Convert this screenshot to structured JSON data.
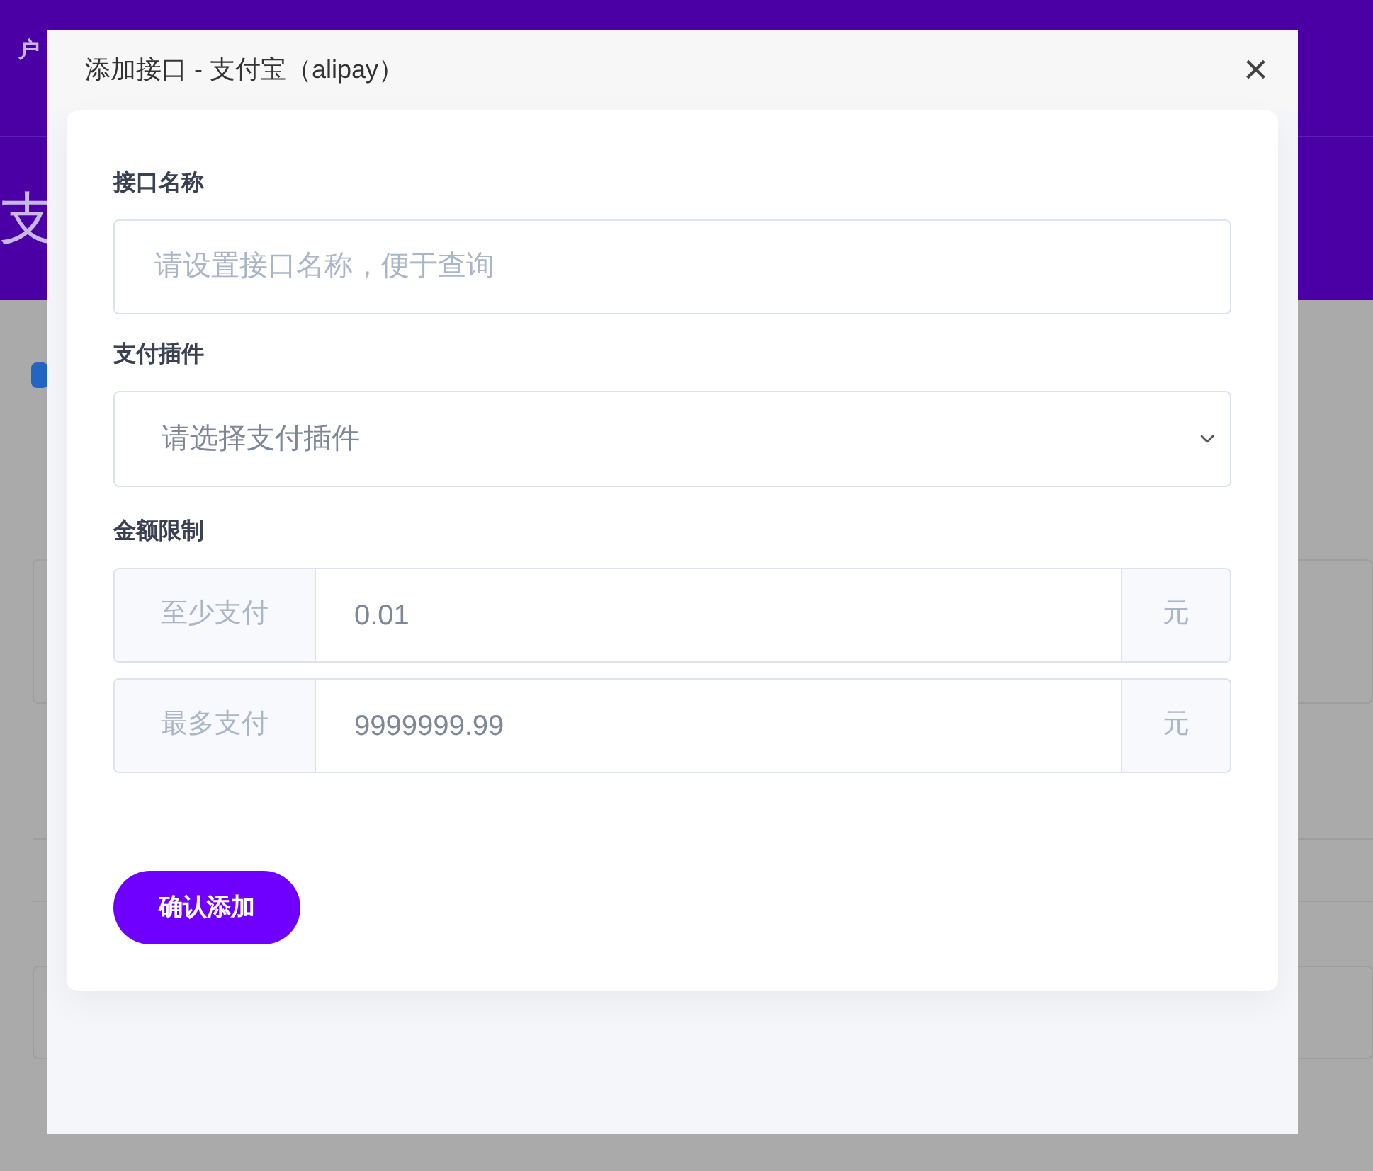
{
  "background": {
    "header_text": "户",
    "page_title": "支"
  },
  "dialog": {
    "title": "添加接口 - 支付宝（alipay）",
    "close": "×",
    "fields": [
      {
        "kind": "text",
        "label": "接口名称",
        "placeholder": "请设置接口名称，便于查询"
      },
      {
        "kind": "select",
        "label": "支付插件",
        "value": "请选择支付插件"
      },
      {
        "kind": "range",
        "label": "金额限制",
        "rows": [
          {
            "prefix": "至少支付",
            "value": "0.01",
            "suffix": "元"
          },
          {
            "prefix": "最多支付",
            "value": "9999999.99",
            "suffix": "元"
          }
        ]
      }
    ],
    "submit": "确认添加"
  }
}
